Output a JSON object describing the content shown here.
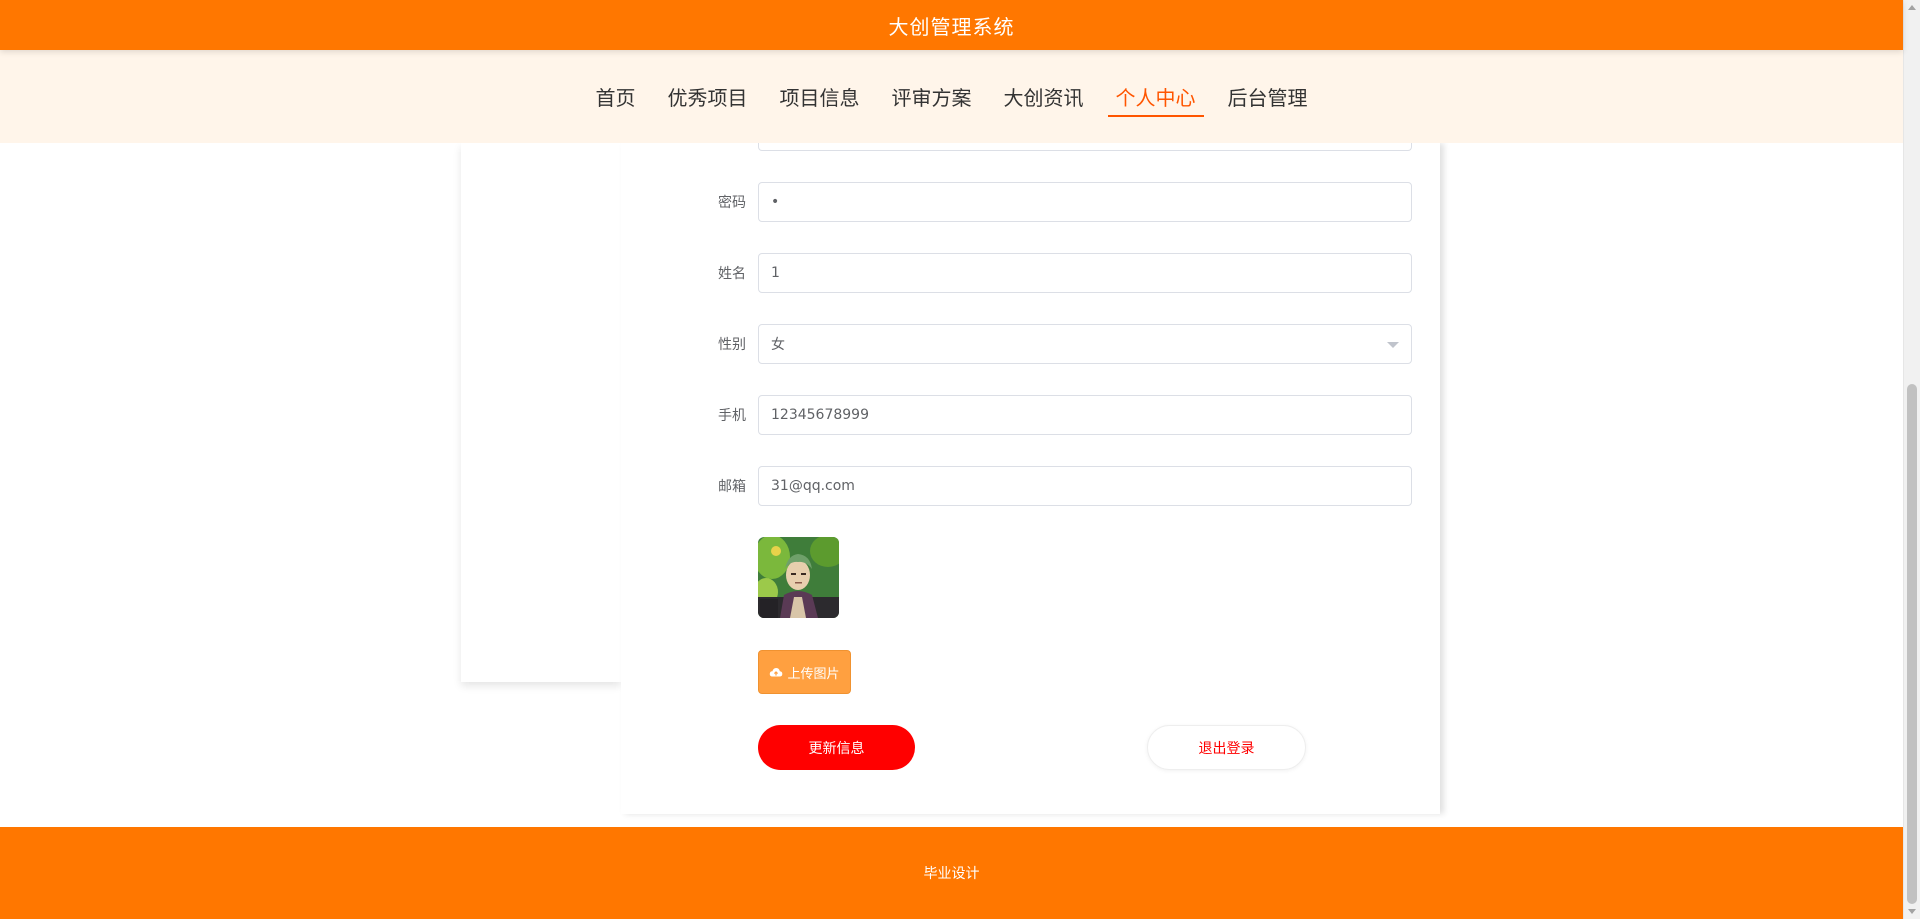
{
  "header": {
    "title": "大创管理系统"
  },
  "nav": {
    "items": [
      {
        "label": "首页"
      },
      {
        "label": "优秀项目"
      },
      {
        "label": "项目信息"
      },
      {
        "label": "评审方案"
      },
      {
        "label": "大创资讯"
      },
      {
        "label": "个人中心",
        "active": true
      },
      {
        "label": "后台管理"
      }
    ]
  },
  "form": {
    "password": {
      "label": "密码",
      "value": "•"
    },
    "name": {
      "label": "姓名",
      "value": "1"
    },
    "gender": {
      "label": "性别",
      "value": "女"
    },
    "phone": {
      "label": "手机",
      "value": "12345678999"
    },
    "email": {
      "label": "邮箱",
      "value": "31@qq.com"
    },
    "upload_label": "上传图片",
    "update_label": "更新信息",
    "logout_label": "退出登录"
  },
  "footer": {
    "text": "毕业设计"
  },
  "colors": {
    "brand_orange": "#ff7700",
    "nav_bg": "#fff5ea",
    "active_nav": "#ff5500",
    "update_button": "#ff0000",
    "upload_button": "#ffa040"
  },
  "icons": {
    "upload": "cloud-upload-icon",
    "select": "chevron-down-icon"
  }
}
